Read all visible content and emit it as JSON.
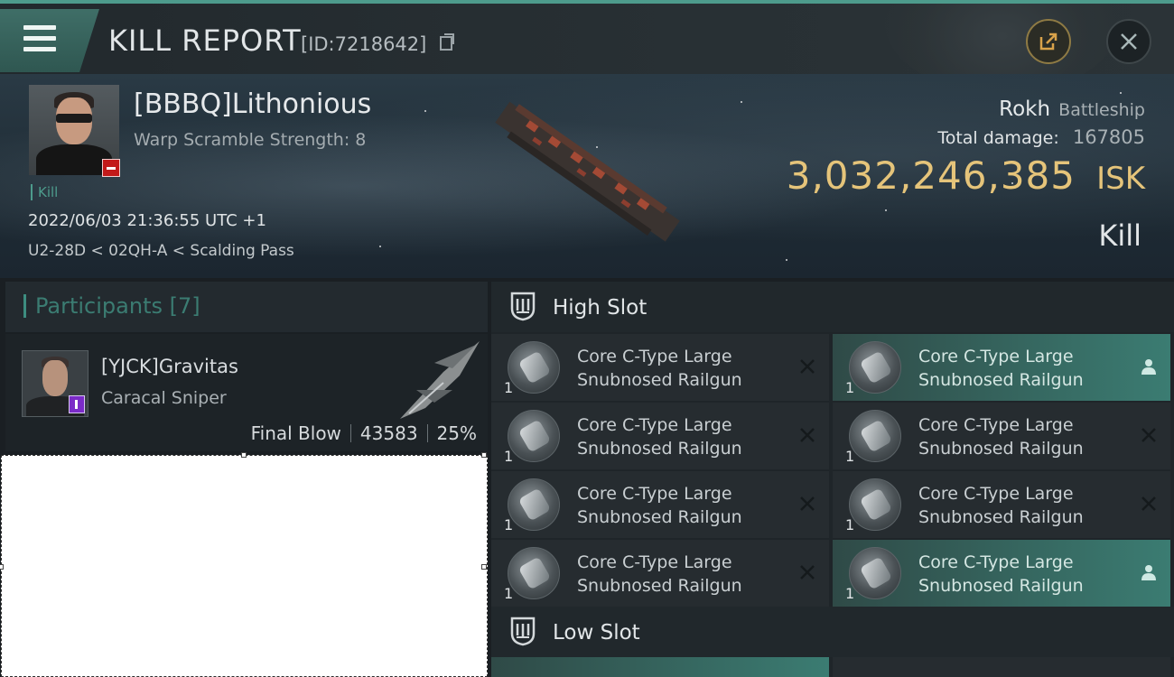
{
  "header": {
    "title": "KILL REPORT",
    "report_id": "[ID:7218642]",
    "menu_icon": "hamburger-menu-icon",
    "share_icon": "share-icon",
    "close_icon": "close-icon"
  },
  "victim": {
    "name": "[BBBQ]Lithonious",
    "warp_scramble": "Warp Scramble Strength: 8",
    "kill_tag": "Kill",
    "datetime": "2022/06/03 21:36:55 UTC +1",
    "location": "U2-28D < 02QH-A < Scalding Pass",
    "ship_name": "Rokh",
    "ship_class": "Battleship",
    "total_damage_label": "Total damage:",
    "total_damage": "167805",
    "isk_value": "3,032,246,385",
    "isk_unit": "ISK",
    "result": "Kill"
  },
  "participants": {
    "header": "Participants [7]",
    "items": [
      {
        "name": "[YJCK]Gravitas",
        "ship": "Caracal Sniper",
        "blow": "Final Blow",
        "damage": "43583",
        "percent": "25%"
      }
    ]
  },
  "high_slot": {
    "title": "High Slot",
    "modules": [
      {
        "qty": "1",
        "line1": "Core C-Type Large",
        "line2": "Snubnosed Railgun",
        "status": "destroyed",
        "active": false
      },
      {
        "qty": "1",
        "line1": "Core C-Type Large",
        "line2": "Snubnosed Railgun",
        "status": "dropped",
        "active": true
      },
      {
        "qty": "1",
        "line1": "Core C-Type Large",
        "line2": "Snubnosed Railgun",
        "status": "destroyed",
        "active": false
      },
      {
        "qty": "1",
        "line1": "Core C-Type Large",
        "line2": "Snubnosed Railgun",
        "status": "destroyed",
        "active": false
      },
      {
        "qty": "1",
        "line1": "Core C-Type Large",
        "line2": "Snubnosed Railgun",
        "status": "destroyed",
        "active": false
      },
      {
        "qty": "1",
        "line1": "Core C-Type Large",
        "line2": "Snubnosed Railgun",
        "status": "destroyed",
        "active": false
      },
      {
        "qty": "1",
        "line1": "Core C-Type Large",
        "line2": "Snubnosed Railgun",
        "status": "destroyed",
        "active": false
      },
      {
        "qty": "1",
        "line1": "Core C-Type Large",
        "line2": "Snubnosed Railgun",
        "status": "dropped",
        "active": true
      }
    ]
  },
  "low_slot": {
    "title": "Low Slot"
  },
  "colors": {
    "accent": "#4d9b8c",
    "isk_gold": "#e5c47a",
    "active_module": "#3b7c72"
  }
}
